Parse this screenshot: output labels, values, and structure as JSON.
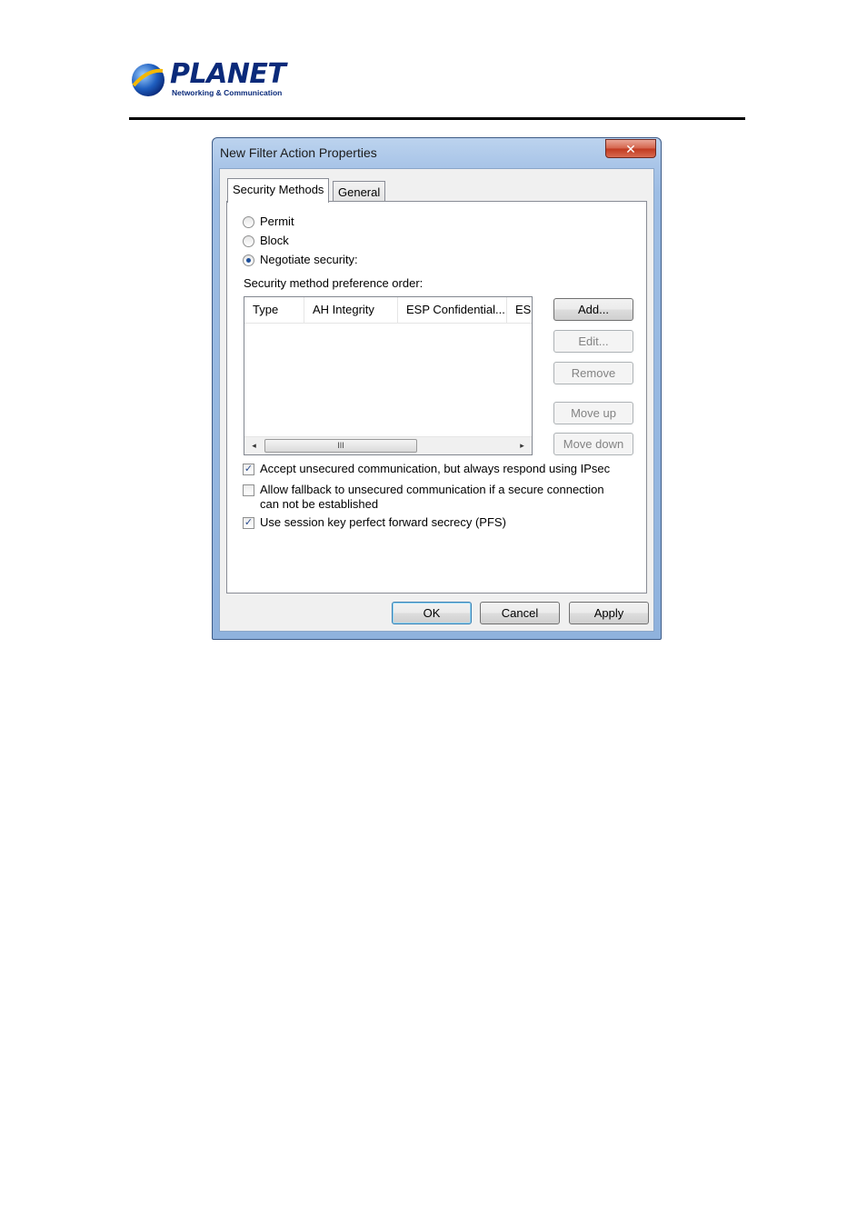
{
  "logo": {
    "word": "PLANET",
    "tagline": "Networking & Communication"
  },
  "window": {
    "title": "New Filter Action Properties",
    "close_glyph": "✕"
  },
  "tabs": [
    {
      "label": "Security Methods",
      "active": true
    },
    {
      "label": "General",
      "active": false
    }
  ],
  "radios": [
    {
      "label": "Permit",
      "checked": false
    },
    {
      "label": "Block",
      "checked": false
    },
    {
      "label": "Negotiate security:",
      "checked": true
    }
  ],
  "list": {
    "caption": "Security method preference order:",
    "columns": [
      "Type",
      "AH Integrity",
      "ESP Confidential...",
      "ES"
    ],
    "rows": [],
    "scroll": {
      "left": "◂",
      "right": "▸",
      "thumb": "III"
    }
  },
  "side_buttons": {
    "add": "Add...",
    "edit": "Edit...",
    "remove": "Remove",
    "move_up": "Move up",
    "move_down": "Move down"
  },
  "checkboxes": [
    {
      "label": "Accept unsecured communication, but always respond using IPsec",
      "checked": true
    },
    {
      "label": "Allow fallback to unsecured communication if a secure connection",
      "label2": "can not be established",
      "checked": false
    },
    {
      "label": "Use session key perfect forward secrecy (PFS)",
      "checked": true
    }
  ],
  "footer": {
    "ok": "OK",
    "cancel": "Cancel",
    "apply": "Apply"
  },
  "colors": {
    "title_bar": "#a9c5e8",
    "close_button": "#c0391f",
    "logo": "#0a2a7a"
  }
}
